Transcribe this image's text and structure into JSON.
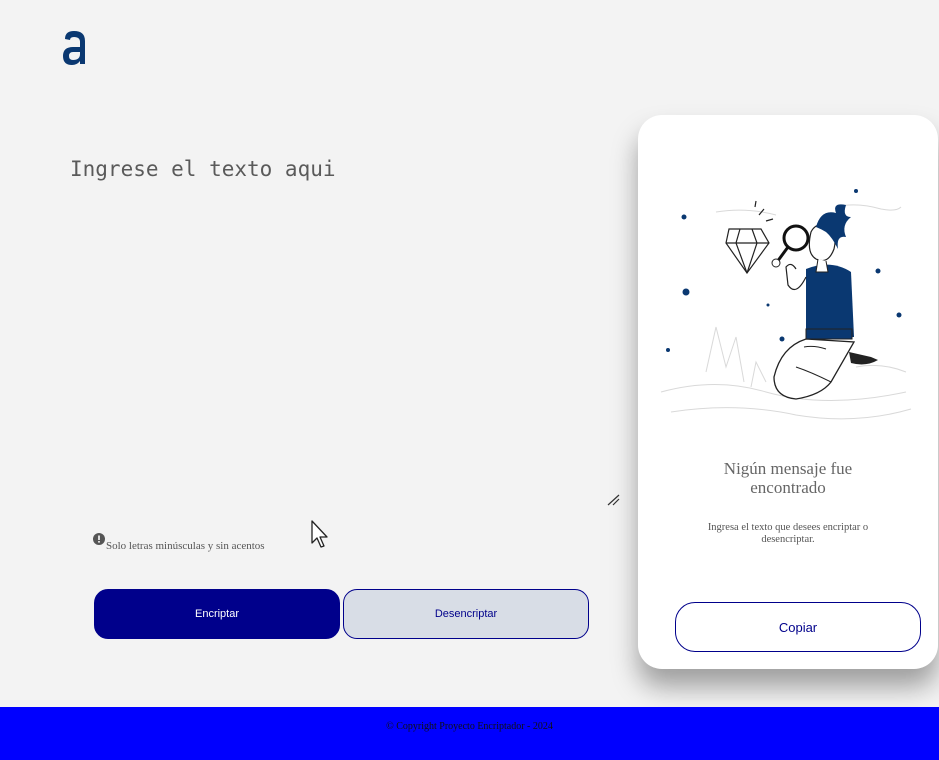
{
  "logo": {
    "icon": "alura-logo-icon",
    "color": "#0a3871"
  },
  "input": {
    "placeholder": "Ingrese el texto aqui",
    "value": ""
  },
  "hint": {
    "icon": "info-icon",
    "text": "Solo letras minúsculas y sin acentos"
  },
  "buttons": {
    "encrypt_label": "Encriptar",
    "decrypt_label": "Desencriptar"
  },
  "output_panel": {
    "illustration": "person-with-magnifier-illustration",
    "title": "Nigún mensaje fue encontrado",
    "subtitle": "Ingresa el texto que desees encriptar o desencriptar.",
    "copy_label": "Copiar"
  },
  "footer": {
    "text": "© Copyright Proyecto Encriptador - 2024"
  },
  "colors": {
    "primary": "#00008b",
    "secondary": "#d8dde6",
    "footer": "#0000ff",
    "background": "#f3f3f3"
  }
}
